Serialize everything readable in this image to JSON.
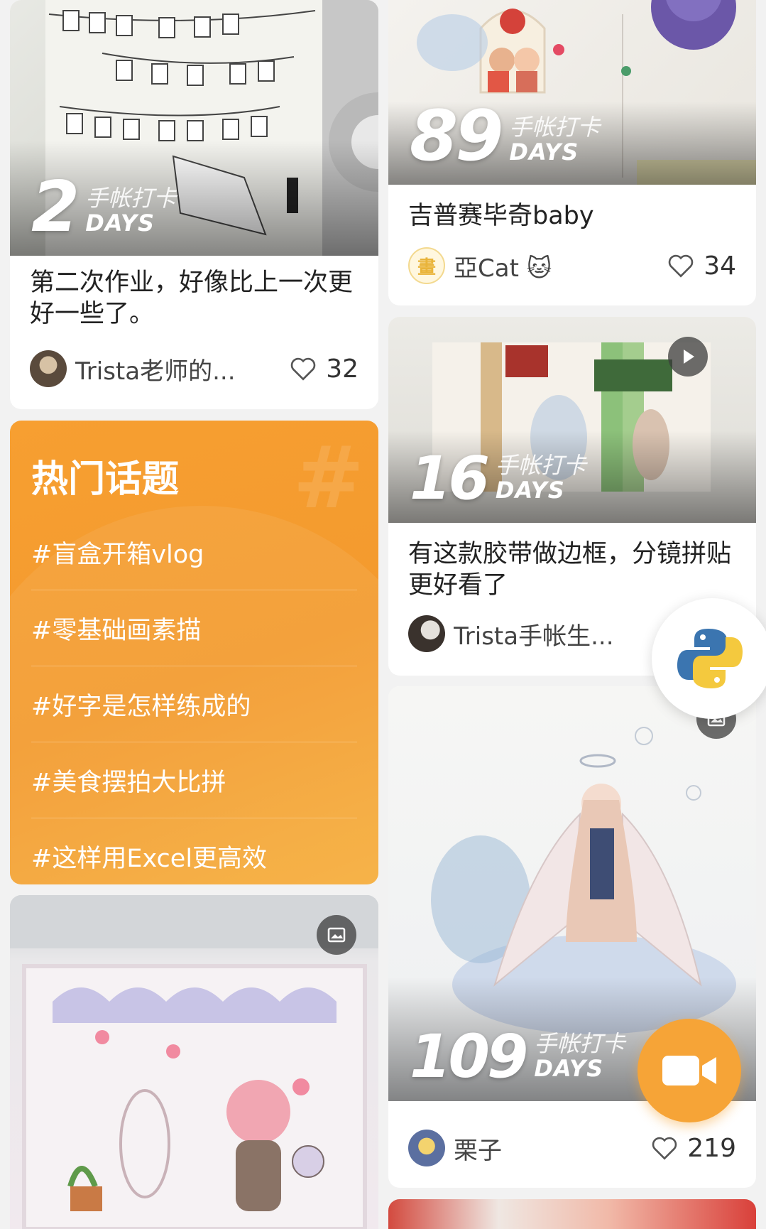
{
  "feed": {
    "left": [
      {
        "days_num": "2",
        "days_cn": "手帐打卡",
        "days_en": "DAYS",
        "title": "第二次作业，好像比上一次更好一些了。",
        "author": "Trista老师的...",
        "likes": "32"
      },
      {
        "media": "image"
      }
    ],
    "right": [
      {
        "days_num": "89",
        "days_cn": "手帐打卡",
        "days_en": "DAYS",
        "title": "吉普赛毕奇baby",
        "author": "亞Cat 🐱",
        "likes": "34"
      },
      {
        "days_num": "16",
        "days_cn": "手帐打卡",
        "days_en": "DAYS",
        "media": "video",
        "title": "有这款胶带做边框，分镜拼贴更好看了",
        "author": "Trista手帐生..."
      },
      {
        "days_num": "109",
        "days_cn": "手帐打卡",
        "days_en": "DAYS",
        "media": "image",
        "author": "栗子",
        "likes": "219"
      }
    ]
  },
  "hot_topics": {
    "title": "热门话题",
    "items": [
      "#盲盒开箱vlog",
      "#零基础画素描",
      "#好字是怎样练成的",
      "#美食摆拍大比拼",
      "#这样用Excel更高效"
    ]
  },
  "fabs": {
    "python_icon": "python-logo-icon",
    "record_icon": "video-camera-icon"
  },
  "colors": {
    "accent": "#f39a2f",
    "topic_bg": "#f79f31"
  }
}
